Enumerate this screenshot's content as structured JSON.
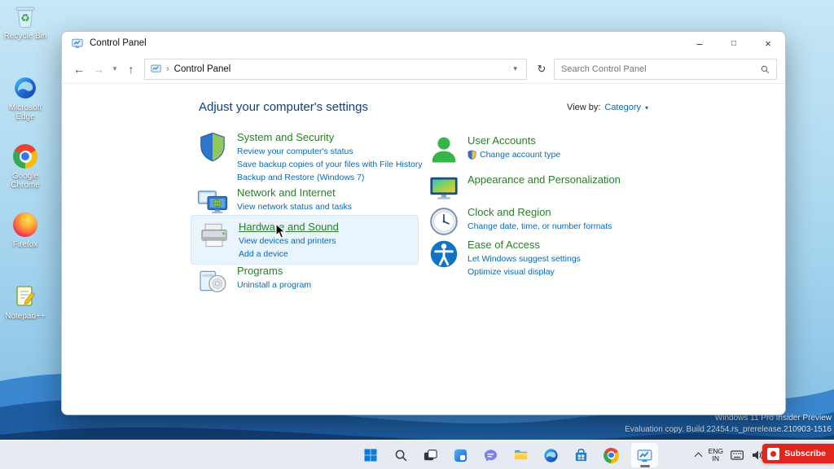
{
  "colors": {
    "category_title_green": "#2a7d2a",
    "link_blue": "#0b68b4",
    "heading_navy": "#10407c",
    "subscribe_red": "#e3261d",
    "taskbar_accent_blue": "#0f7bd7"
  },
  "desktop": {
    "recycle_glyph": "♻",
    "icons": [
      {
        "label": "Recycle Bin"
      },
      {
        "label": "Microsoft Edge"
      },
      {
        "label": "Google Chrome"
      },
      {
        "label": "Firefox"
      },
      {
        "label": "Notepad++"
      }
    ],
    "watermark": {
      "line1": "Windows 11 Pro Insider Preview",
      "line2": "Evaluation copy. Build 22454.rs_prerelease.210903-1516"
    }
  },
  "window": {
    "title": "Control Panel",
    "controls": {
      "minimize": "–",
      "maximize": "□",
      "close": "×"
    },
    "nav": {
      "back": "←",
      "forward": "→",
      "recent_caret": "▾",
      "up": "↑",
      "crumb_chevron": "›",
      "breadcrumb": "Control Panel",
      "crumb_caret": "▾",
      "refresh": "↻",
      "search_placeholder": "Search Control Panel"
    },
    "heading": "Adjust your computer's settings",
    "view_by": {
      "label": "View by:",
      "value": "Category",
      "caret": "▾"
    },
    "left": [
      {
        "title": "System and Security",
        "links": [
          "Review your computer's status",
          "Save backup copies of your files with File History",
          "Backup and Restore (Windows 7)"
        ]
      },
      {
        "title": "Network and Internet",
        "links": [
          "View network status and tasks"
        ]
      },
      {
        "title": "Hardware and Sound",
        "links": [
          "View devices and printers",
          "Add a device"
        ]
      },
      {
        "title": "Programs",
        "links": [
          "Uninstall a program"
        ]
      }
    ],
    "right": [
      {
        "title": "User Accounts",
        "links": [
          "Change account type"
        ]
      },
      {
        "title": "Appearance and Personalization",
        "links": []
      },
      {
        "title": "Clock and Region",
        "links": [
          "Change date, time, or number formats"
        ]
      },
      {
        "title": "Ease of Access",
        "links": [
          "Let Windows suggest settings",
          "Optimize visual display"
        ]
      }
    ]
  },
  "taskbar": {
    "tray": {
      "lang_line1": "ENG",
      "lang_line2": "IN"
    },
    "subscribe_label": "Subscribe"
  }
}
